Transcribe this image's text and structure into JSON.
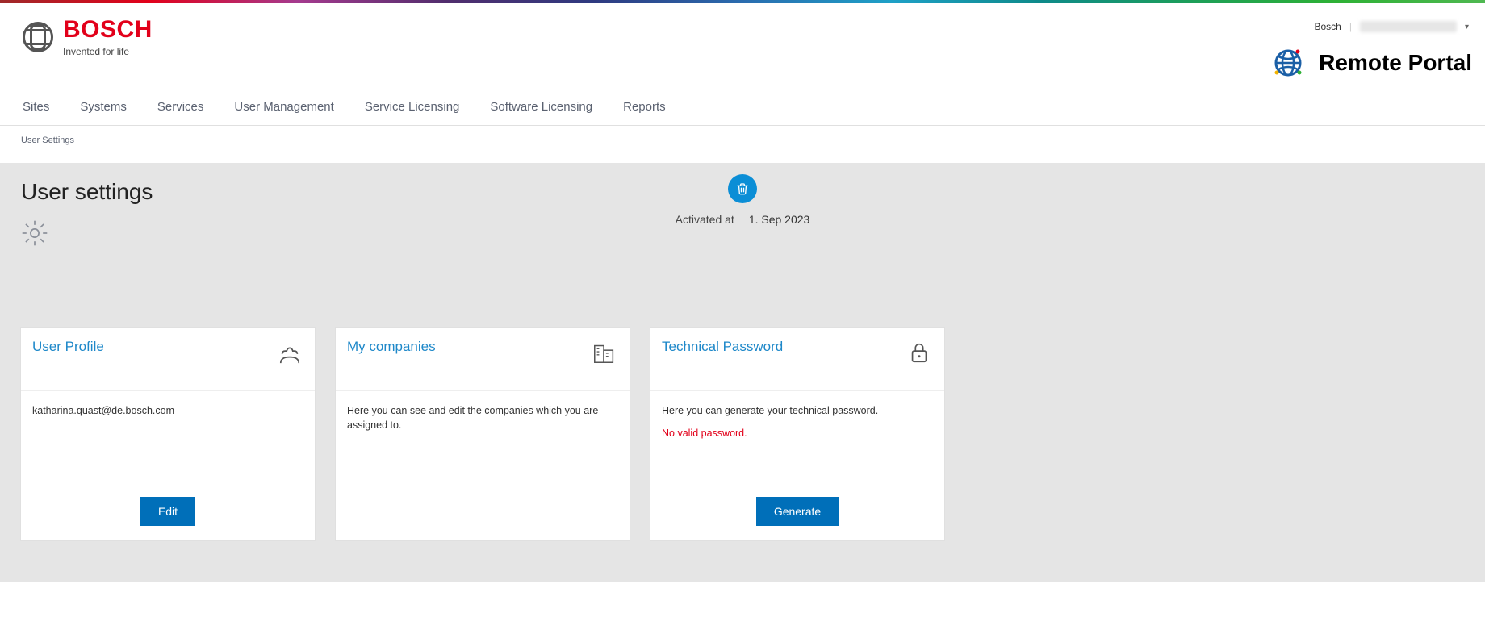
{
  "brand": {
    "name": "BOSCH",
    "tagline": "Invented for life"
  },
  "portal": {
    "title": "Remote Portal"
  },
  "user_menu": {
    "label": "Bosch"
  },
  "nav": {
    "sites": "Sites",
    "systems": "Systems",
    "services": "Services",
    "user_mgmt": "User Management",
    "service_lic": "Service Licensing",
    "software_lic": "Software Licensing",
    "reports": "Reports"
  },
  "breadcrumb": {
    "user_settings": "User Settings"
  },
  "page": {
    "title": "User settings"
  },
  "activation": {
    "label": "Activated at",
    "date": "1. Sep 2023"
  },
  "cards": {
    "profile": {
      "title": "User Profile",
      "email": "katharina.quast@de.bosch.com",
      "action": "Edit"
    },
    "companies": {
      "title": "My companies",
      "body": "Here you can see and edit the companies which you are assigned to."
    },
    "tech_pw": {
      "title": "Technical Password",
      "body": "Here you can generate your technical password.",
      "warn": "No valid password.",
      "action": "Generate"
    }
  }
}
